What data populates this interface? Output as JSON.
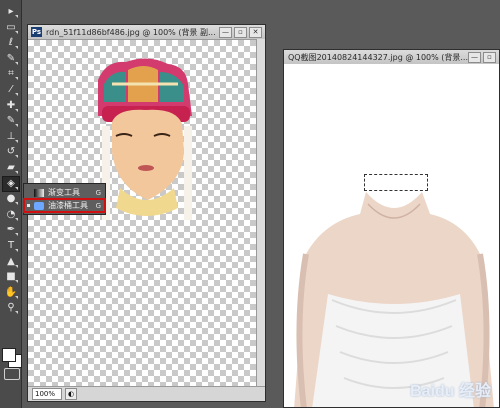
{
  "toolbar": {
    "tools": [
      {
        "name": "move-tool",
        "glyph": "▸"
      },
      {
        "name": "marquee-tool",
        "glyph": "▭"
      },
      {
        "name": "lasso-tool",
        "glyph": "ℓ"
      },
      {
        "name": "quick-selection-tool",
        "glyph": "✎"
      },
      {
        "name": "crop-tool",
        "glyph": "⌗"
      },
      {
        "name": "eyedropper-tool",
        "glyph": "⁄"
      },
      {
        "name": "healing-brush-tool",
        "glyph": "✚"
      },
      {
        "name": "brush-tool",
        "glyph": "✎"
      },
      {
        "name": "clone-stamp-tool",
        "glyph": "⊥"
      },
      {
        "name": "history-brush-tool",
        "glyph": "↺"
      },
      {
        "name": "eraser-tool",
        "glyph": "▰"
      },
      {
        "name": "paint-bucket-tool",
        "glyph": "◈"
      },
      {
        "name": "blur-tool",
        "glyph": "●"
      },
      {
        "name": "dodge-tool",
        "glyph": "◔"
      },
      {
        "name": "pen-tool",
        "glyph": "✒"
      },
      {
        "name": "type-tool",
        "glyph": "T"
      },
      {
        "name": "path-selection-tool",
        "glyph": "▲"
      },
      {
        "name": "shape-tool",
        "glyph": "■"
      },
      {
        "name": "hand-tool",
        "glyph": "✋"
      },
      {
        "name": "zoom-tool",
        "glyph": "⚲"
      }
    ]
  },
  "window1": {
    "title": "rdn_51f11d86bf486.jpg @ 100% (背景 副...",
    "zoom": "100%",
    "buttons": {
      "minimize": "—",
      "restore": "▫",
      "close": "✕"
    }
  },
  "flyout": {
    "items": [
      {
        "label": "渐变工具",
        "key": "G"
      },
      {
        "label": "油漆桶工具",
        "key": "G"
      }
    ]
  },
  "window2": {
    "title": "QQ截图20140824144327.jpg @ 100% (背景...",
    "buttons": {
      "minimize": "—",
      "restore": "▫"
    },
    "watermark": "Baidu 经验"
  }
}
